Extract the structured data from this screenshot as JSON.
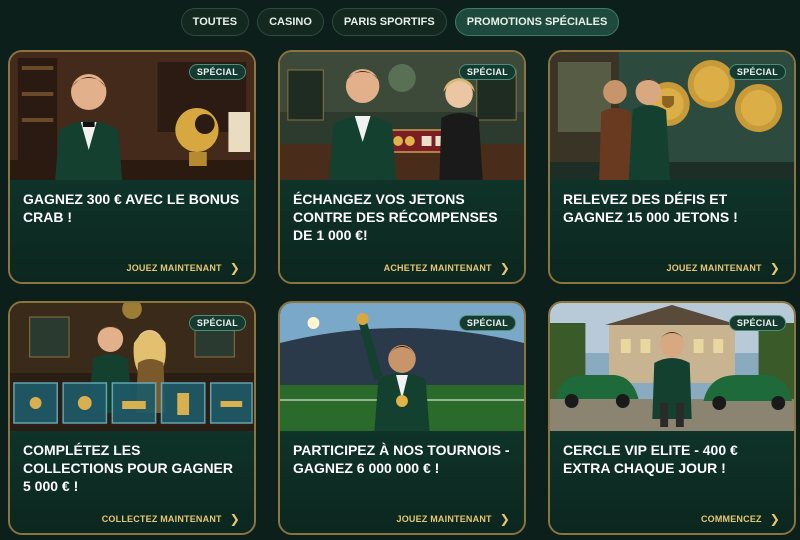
{
  "tabs": [
    {
      "label": "TOUTES",
      "active": false
    },
    {
      "label": "CASINO",
      "active": false
    },
    {
      "label": "PARIS SPORTIFS",
      "active": false
    },
    {
      "label": "PROMOTIONS SPÉCIALES",
      "active": true
    }
  ],
  "cards": [
    {
      "badge": "SPÉCIAL",
      "title": "GAGNEZ 300 € AVEC LE BONUS CRAB !",
      "cta": "JOUEZ MAINTENANT"
    },
    {
      "badge": "SPÉCIAL",
      "title": "ÉCHANGEZ VOS JETONS CONTRE DES RÉCOMPENSES DE 1 000 €!",
      "cta": "ACHETEZ MAINTENANT"
    },
    {
      "badge": "SPÉCIAL",
      "title": "RELEVEZ DES DÉFIS ET GAGNEZ 15 000 JETONS !",
      "cta": "JOUEZ MAINTENANT"
    },
    {
      "badge": "SPÉCIAL",
      "title": "COMPLÉTEZ LES COLLECTIONS POUR GAGNER 5 000 € !",
      "cta": "COLLECTEZ MAINTENANT"
    },
    {
      "badge": "SPÉCIAL",
      "title": "PARTICIPEZ À NOS TOURNOIS - GAGNEZ 6 000 000 € !",
      "cta": "JOUEZ MAINTENANT"
    },
    {
      "badge": "SPÉCIAL",
      "title": "CERCLE VIP ELITE - 400 € EXTRA CHAQUE JOUR !",
      "cta": "COMMENCEZ"
    }
  ],
  "icons": {
    "cta_chevron": "chevron-right-icon"
  },
  "colors": {
    "background": "#0d1f1a",
    "card_border": "#8a7440",
    "cta": "#e7c774",
    "badge_border": "#4c8f78"
  }
}
